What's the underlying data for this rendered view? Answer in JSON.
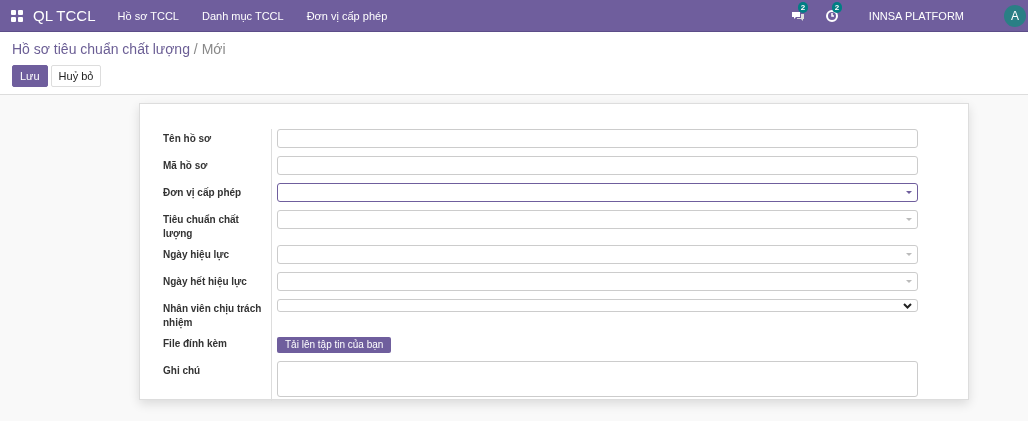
{
  "navbar": {
    "app_name": "QL TCCL",
    "menu": [
      {
        "label": "Hồ sơ TCCL"
      },
      {
        "label": "Danh mục TCCL"
      },
      {
        "label": "Đơn vị cấp phép"
      }
    ],
    "messages_badge": "2",
    "activities_badge": "2",
    "company": "INNSA PLATFORM",
    "avatar": "A"
  },
  "breadcrumb": {
    "parent": "Hồ sơ tiêu chuẩn chất lượng",
    "separator": "/",
    "current": "Mới"
  },
  "buttons": [
    {
      "label": "Lưu",
      "kind": "primary"
    },
    {
      "label": "Huỷ bỏ",
      "kind": "secondary"
    }
  ],
  "form": {
    "fields": [
      {
        "label": "Tên hồ sơ",
        "kind": "text",
        "focused": false
      },
      {
        "label": "Mã hồ sơ",
        "kind": "text",
        "focused": false
      },
      {
        "label": "Đơn vị cấp phép",
        "kind": "dropdown",
        "focused": true
      },
      {
        "label": "Tiêu chuẩn chất lượng",
        "kind": "dropdown",
        "focused": false
      },
      {
        "label": "Ngày hiệu lực",
        "kind": "dropdown",
        "focused": false
      },
      {
        "label": "Ngày hết hiệu lực",
        "kind": "dropdown",
        "focused": false
      },
      {
        "label": "Nhân viên chịu trách nhiệm",
        "kind": "select",
        "focused": false
      },
      {
        "label": "File đính kèm",
        "kind": "upload",
        "button": "Tải lên tập tin của bạn"
      },
      {
        "label": "Ghi chú",
        "kind": "textarea",
        "focused": false
      }
    ]
  }
}
